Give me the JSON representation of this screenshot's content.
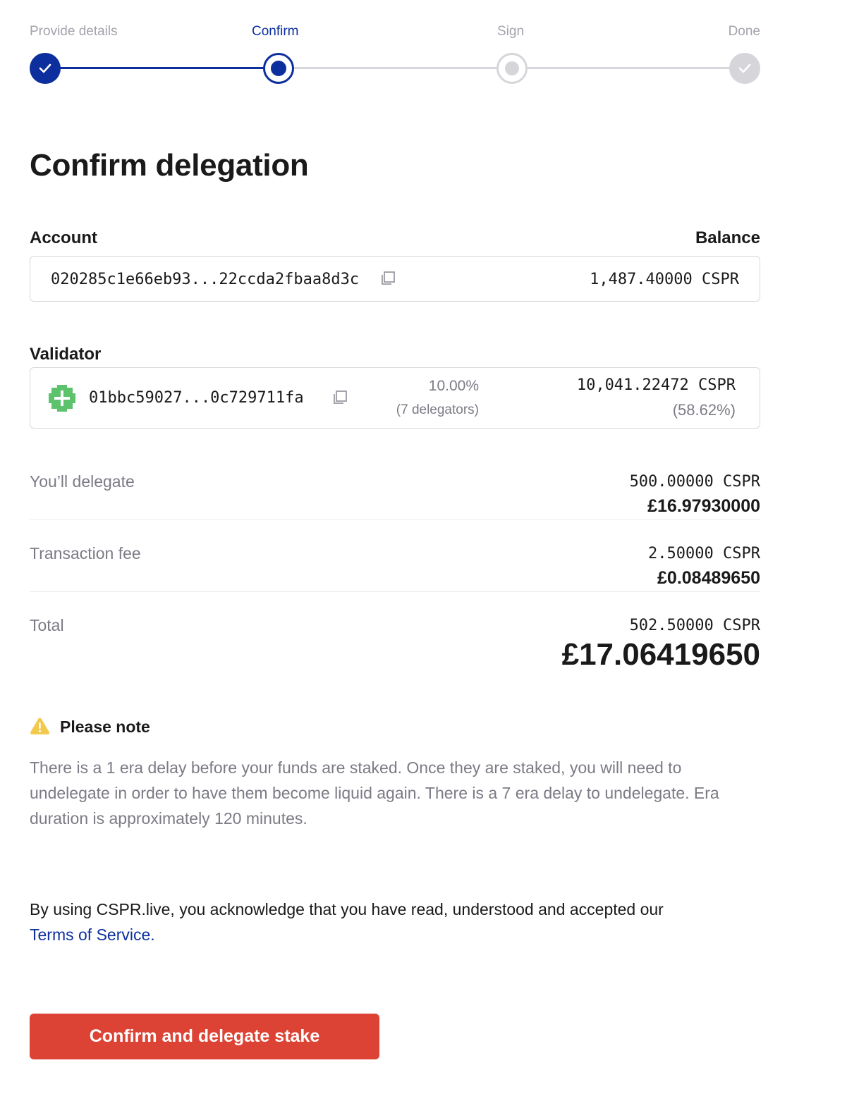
{
  "stepper": {
    "steps": [
      {
        "label": "Provide details",
        "state": "done"
      },
      {
        "label": "Confirm",
        "state": "current"
      },
      {
        "label": "Sign",
        "state": "pending"
      },
      {
        "label": "Done",
        "state": "pending"
      }
    ]
  },
  "page": {
    "title": "Confirm delegation"
  },
  "account": {
    "section_label": "Account",
    "balance_label": "Balance",
    "hash": "020285c1e66eb93...22ccda2fbaa8d3c",
    "balance": "1,487.40000 CSPR"
  },
  "validator": {
    "section_label": "Validator",
    "hash": "01bbc59027...0c729711fa",
    "fee": "10.00%",
    "delegators": "(7 delegators)",
    "total_stake": "10,041.22472 CSPR",
    "stake_share": "(58.62%)"
  },
  "summary": {
    "delegate": {
      "label": "You’ll delegate",
      "cspr": "500.00000 CSPR",
      "fiat": "£16.97930000"
    },
    "fee": {
      "label": "Transaction fee",
      "cspr": "2.50000 CSPR",
      "fiat": "£0.08489650"
    },
    "total": {
      "label": "Total",
      "cspr": "502.50000 CSPR",
      "fiat": "£17.06419650"
    }
  },
  "note": {
    "title": "Please note",
    "body": "There is a 1 era delay before your funds are staked. Once they are staked, you will need to undelegate in order to have them become liquid again. There is a 7 era delay to undelegate. Era duration is approximately 120 minutes."
  },
  "terms": {
    "text": "By using CSPR.live, you acknowledge that you have read, understood and accepted our",
    "link": "Terms of Service."
  },
  "actions": {
    "confirm_label": "Confirm and delegate stake"
  },
  "colors": {
    "primary": "#0d2f9e",
    "cta": "#dd4335",
    "muted": "#7b7b85",
    "warning": "#f2c94c",
    "avatar": "#5cc26c"
  },
  "icons": [
    "check-icon",
    "copy-icon",
    "warning-icon",
    "validator-avatar"
  ]
}
